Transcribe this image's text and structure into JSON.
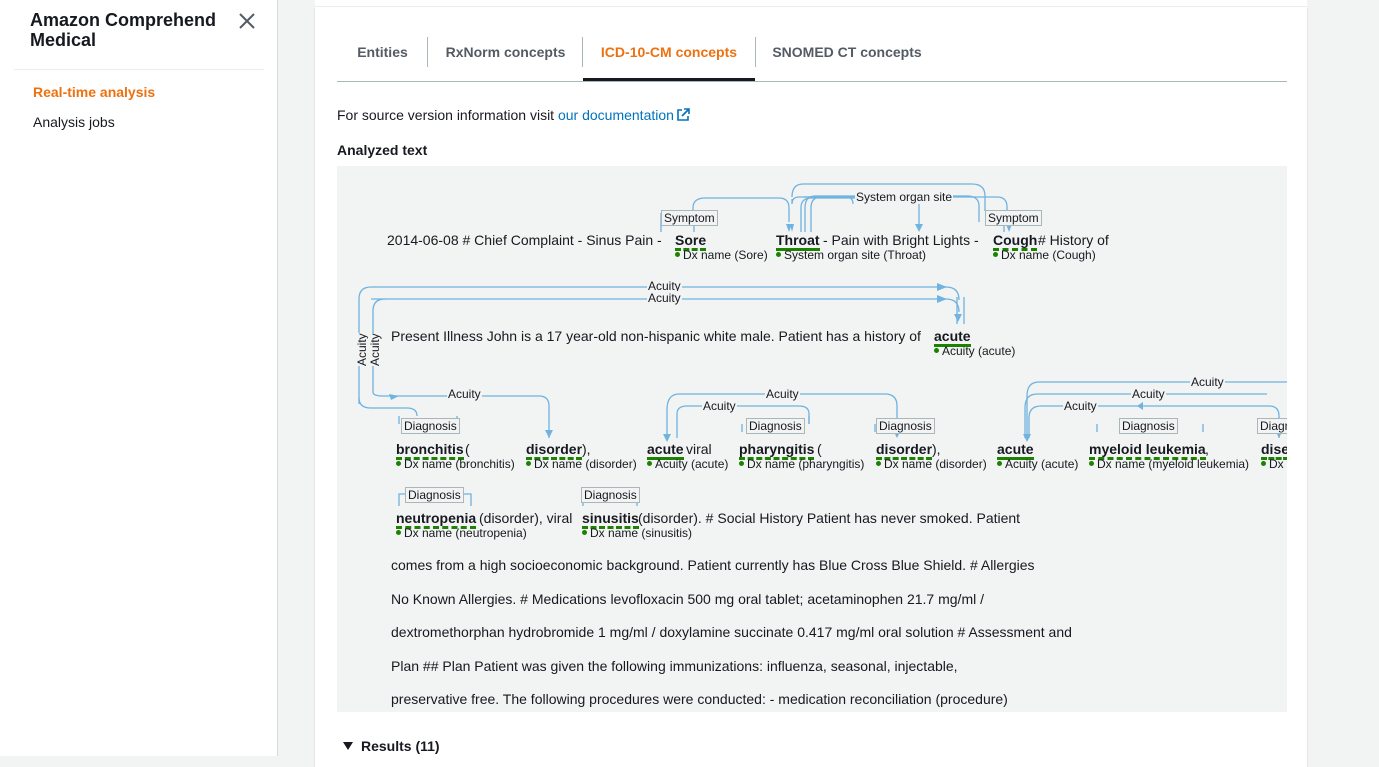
{
  "sidebar": {
    "title": "Amazon Comprehend Medical",
    "items": [
      {
        "label": "Real-time analysis"
      },
      {
        "label": "Analysis jobs"
      }
    ]
  },
  "tabs": [
    {
      "label": "Entities"
    },
    {
      "label": "RxNorm concepts"
    },
    {
      "label": "ICD-10-CM concepts"
    },
    {
      "label": "SNOMED CT concepts"
    }
  ],
  "source": {
    "prefix": "For source version information visit",
    "link": "our documentation"
  },
  "analyzed_label": "Analyzed text",
  "line1": {
    "before": "2014-06-08 # Chief Complaint - Sinus Pain -",
    "sore": "Sore",
    "throat": "Throat",
    "mid": "- Pain with Bright Lights -",
    "cough": "Cough",
    "after": "# History of",
    "sore_sub": "Dx name (Sore)",
    "throat_sub": "System organ site (Throat)",
    "cough_sub": "Dx name (Cough)",
    "tag_symptom": "Symptom",
    "rel_sos": "System organ site"
  },
  "line2": {
    "text": "Present Illness John is a 17 year-old non-hispanic white male. Patient has a history of",
    "acute": "acute",
    "acute_sub": "Acuity (acute)",
    "rel_acuity": "Acuity"
  },
  "line3": {
    "bronchitis": "bronchitis",
    "paren_open": "(",
    "disorder": "disorder",
    "close_comma": "),",
    "viral": "viral",
    "pharyngitis": "pharyngitis",
    "myeloid": "myeloid leukemia",
    "comma": ",",
    "dise": "dise",
    "sub_bronchitis": "Dx name (bronchitis)",
    "sub_disorder": "Dx name (disorder)",
    "sub_acute": "Acuity (acute)",
    "sub_pharyngitis": "Dx name (pharyngitis)",
    "sub_myeloid": "Dx name (myeloid leukemia)",
    "sub_dx": "Dx",
    "tag_diagnosis": "Diagnosis",
    "tag_diag_cut": "Diagn"
  },
  "line4": {
    "neutropenia": "neutropenia",
    "after_neutro": "(disorder), viral",
    "sinusitis": "sinusitis",
    "after_sinus": "(disorder). # Social History Patient has never smoked. Patient",
    "sub_neutro": "Dx name (neutropenia)",
    "sub_sinus": "Dx name (sinusitis)"
  },
  "plain_lines": [
    "comes from a high socioeconomic background. Patient currently has Blue Cross Blue Shield. # Allergies",
    "No Known Allergies. # Medications levofloxacin 500 mg oral tablet; acetaminophen 21.7 mg/ml /",
    "dextromethorphan hydrobromide 1 mg/ml / doxylamine succinate 0.417 mg/ml oral solution # Assessment and",
    "Plan ## Plan Patient was given the following immunizations: influenza, seasonal, injectable,",
    "preservative free. The following procedures were conducted: - medication reconciliation  (procedure)"
  ],
  "results_label": "Results (11)",
  "colors": {
    "accent": "#ec7211",
    "link": "#0073bb",
    "entity": "#1d8102",
    "arc": "#6fb3e0"
  }
}
